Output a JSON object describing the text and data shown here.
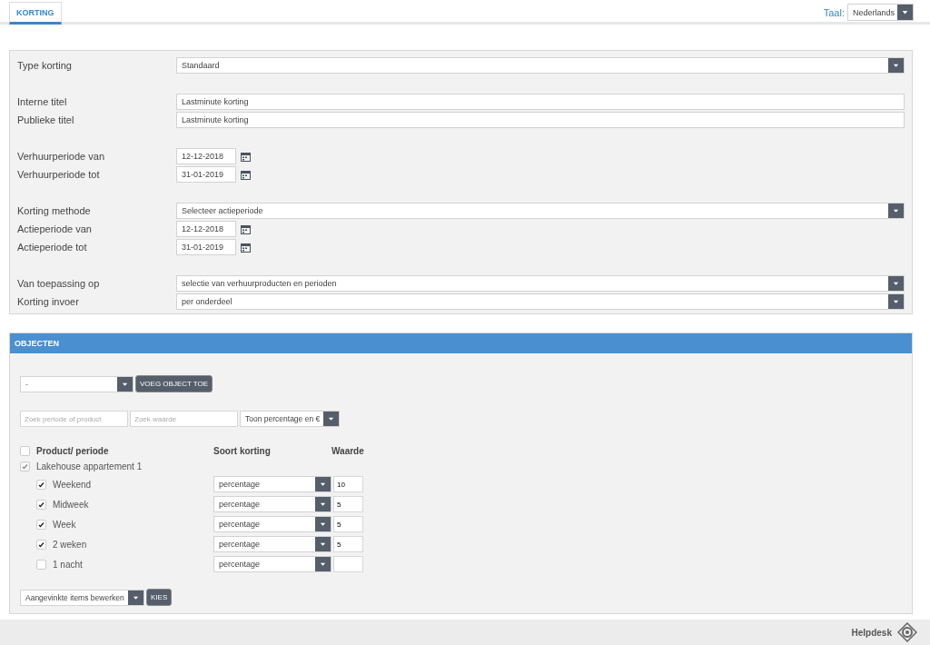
{
  "tabs": [
    {
      "label": "KORTING",
      "selected": true
    }
  ],
  "language": {
    "label": "Taal:",
    "value": "Nederlands"
  },
  "form": {
    "groups": [
      [
        {
          "label": "Type korting",
          "kind": "select",
          "value": "Standaard"
        }
      ],
      [
        {
          "label": "Interne titel",
          "kind": "text",
          "value": "Lastminute korting"
        },
        {
          "label": "Publieke titel",
          "kind": "text",
          "value": "Lastminute korting"
        }
      ],
      [
        {
          "label": "Verhuurperiode van",
          "kind": "date",
          "value": "12-12-2018"
        },
        {
          "label": "Verhuurperiode tot",
          "kind": "date",
          "value": "31-01-2019"
        }
      ],
      [
        {
          "label": "Korting methode",
          "kind": "select",
          "value": "Selecteer actieperiode"
        },
        {
          "label": "Actieperiode van",
          "kind": "date",
          "value": "12-12-2018"
        },
        {
          "label": "Actieperiode tot",
          "kind": "date",
          "value": "31-01-2019"
        }
      ],
      [
        {
          "label": "Van toepassing op",
          "kind": "select",
          "value": "selectie van verhuurproducten en perioden"
        },
        {
          "label": "Korting invoer",
          "kind": "select",
          "value": "per onderdeel"
        }
      ]
    ]
  },
  "objects": {
    "title": "OBJECTEN",
    "object_select": "-",
    "add_button": "VOEG OBJECT TOE",
    "search_product": {
      "placeholder": "Zoek periode of product"
    },
    "search_value": {
      "placeholder": "Zoek waarde"
    },
    "display_select": "Toon percentage en €",
    "header": {
      "checked": false,
      "columns": [
        "Product/ periode",
        "Soort korting",
        "Waarde"
      ]
    },
    "tree": [
      {
        "label": "Lakehouse appartement 1",
        "checked": true,
        "disabled": true,
        "children": [
          {
            "label": "Weekend",
            "checked": true,
            "type": "percentage",
            "value": "10"
          },
          {
            "label": "Midweek",
            "checked": true,
            "type": "percentage",
            "value": "5"
          },
          {
            "label": "Week",
            "checked": true,
            "type": "percentage",
            "value": "5"
          },
          {
            "label": "2 weken",
            "checked": true,
            "type": "percentage",
            "value": "5"
          },
          {
            "label": "1 nacht",
            "checked": false,
            "type": "percentage"
          }
        ]
      }
    ],
    "bulk_select": "Aangevinkte items bewerken",
    "bulk_button": "KIES"
  },
  "footer": {
    "helpdesk": "Helpdesk"
  }
}
